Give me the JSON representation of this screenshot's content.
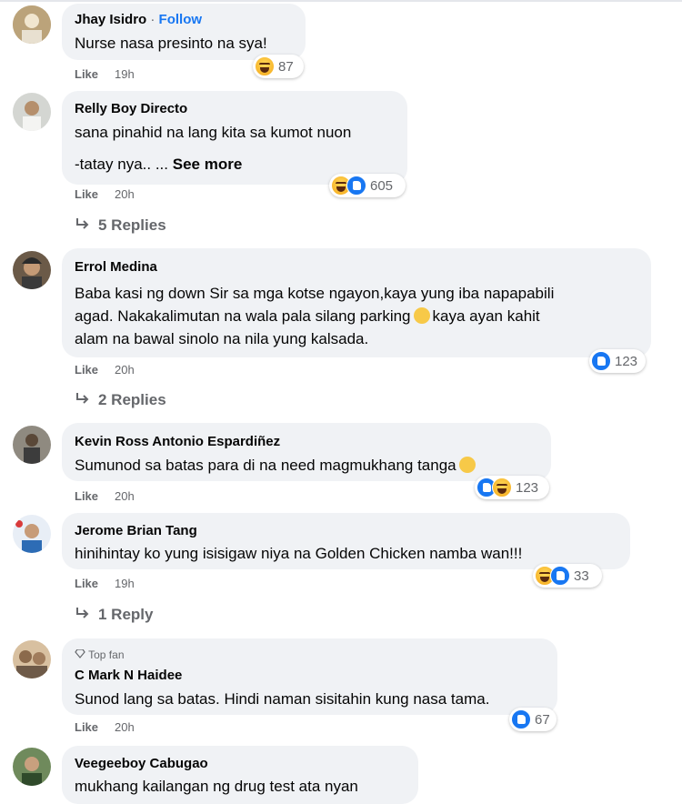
{
  "comments": [
    {
      "author": "Jhay Isidro",
      "follow": "Follow",
      "text": [
        "Nurse nasa presinto na sya!"
      ],
      "like": "Like",
      "time": "19h",
      "reaction_count": "87"
    },
    {
      "author": "Relly Boy Directo",
      "text": [
        "sana pinahid na lang kita sa kumot nuon",
        "-tatay nya.. ..."
      ],
      "see_more": "See more",
      "like": "Like",
      "time": "20h",
      "reaction_count": "605",
      "replies": "5 Replies"
    },
    {
      "author": "Errol Medina",
      "text": [
        "Baba kasi ng down Sir sa mga kotse ngayon,kaya yung iba napapabili",
        "agad. Nakakalimutan na wala pala silang parking",
        "kaya ayan kahit",
        "alam na bawal sinolo na nila yung kalsada."
      ],
      "like": "Like",
      "time": "20h",
      "reaction_count": "123",
      "replies": "2 Replies"
    },
    {
      "author": "Kevin Ross Antonio Espardiñez",
      "text": [
        "Sumunod sa batas para di na need magmukhang tanga"
      ],
      "like": "Like",
      "time": "20h",
      "reaction_count": "123"
    },
    {
      "author": "Jerome Brian Tang",
      "text": [
        "hinihintay ko yung isisigaw niya na Golden Chicken namba wan!!!"
      ],
      "like": "Like",
      "time": "19h",
      "reaction_count": "33",
      "replies": "1 Reply"
    },
    {
      "badge": "Top fan",
      "author": "C Mark N Haidee",
      "text": [
        "Sunod lang sa batas. Hindi naman sisitahin kung nasa tama."
      ],
      "like": "Like",
      "time": "20h",
      "reaction_count": "67"
    },
    {
      "author": "Veegeeboy Cabugao",
      "text": [
        "mukhang kailangan ng drug test ata nyan"
      ]
    }
  ],
  "icons": {
    "reply": "reply-arrow-icon",
    "haha": "haha-reaction-icon",
    "like": "like-reaction-icon",
    "topfan": "diamond-icon"
  }
}
